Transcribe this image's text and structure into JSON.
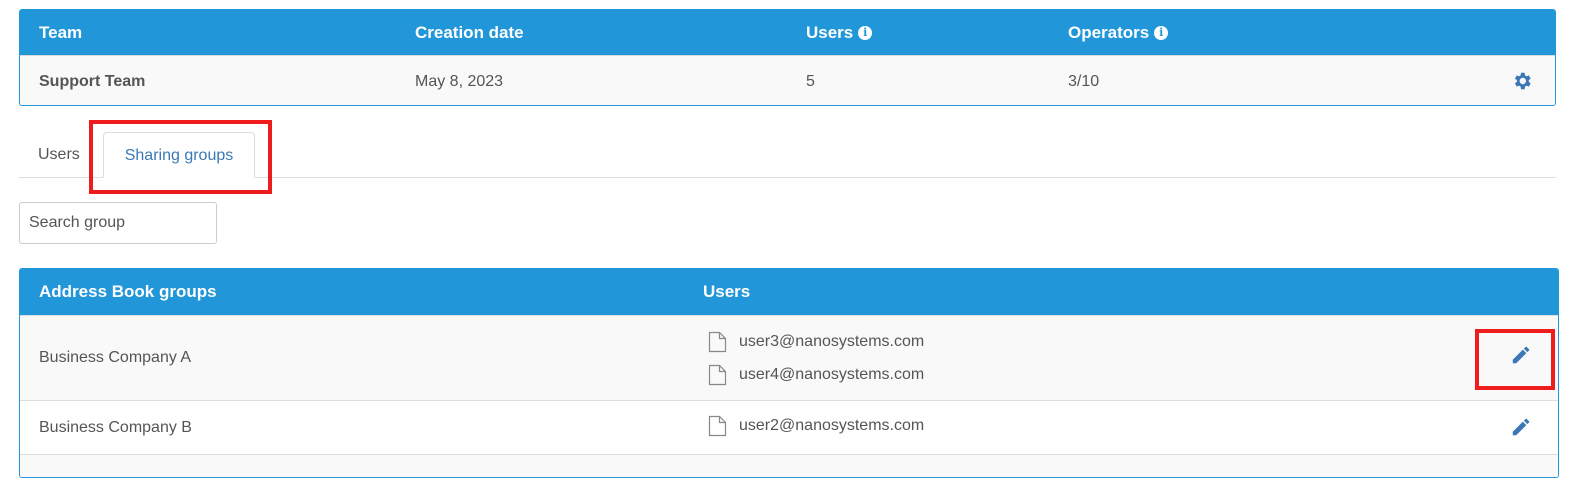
{
  "team_table": {
    "headers": {
      "team": "Team",
      "creation_date": "Creation date",
      "users": "Users",
      "operators": "Operators"
    },
    "row": {
      "team": "Support Team",
      "creation_date": "May 8, 2023",
      "users": "5",
      "operators": "3/10"
    },
    "info_icon": "info-icon",
    "settings_icon": "gear-icon"
  },
  "tabs": [
    {
      "label": "Users",
      "active": false
    },
    {
      "label": "Sharing groups",
      "active": true
    }
  ],
  "search": {
    "placeholder": "Search group",
    "value": ""
  },
  "groups_table": {
    "headers": {
      "group": "Address Book groups",
      "users": "Users"
    },
    "rows": [
      {
        "name": "Business Company A",
        "users": [
          "user3@nanosystems.com",
          "user4@nanosystems.com"
        ]
      },
      {
        "name": "Business Company B",
        "users": [
          "user2@nanosystems.com"
        ]
      }
    ],
    "user_icon": "document-icon",
    "edit_icon": "pencil-icon"
  },
  "colors": {
    "header_blue": "#2196d9",
    "link_blue": "#3b78b5",
    "highlight_red": "#ee1c1c"
  }
}
